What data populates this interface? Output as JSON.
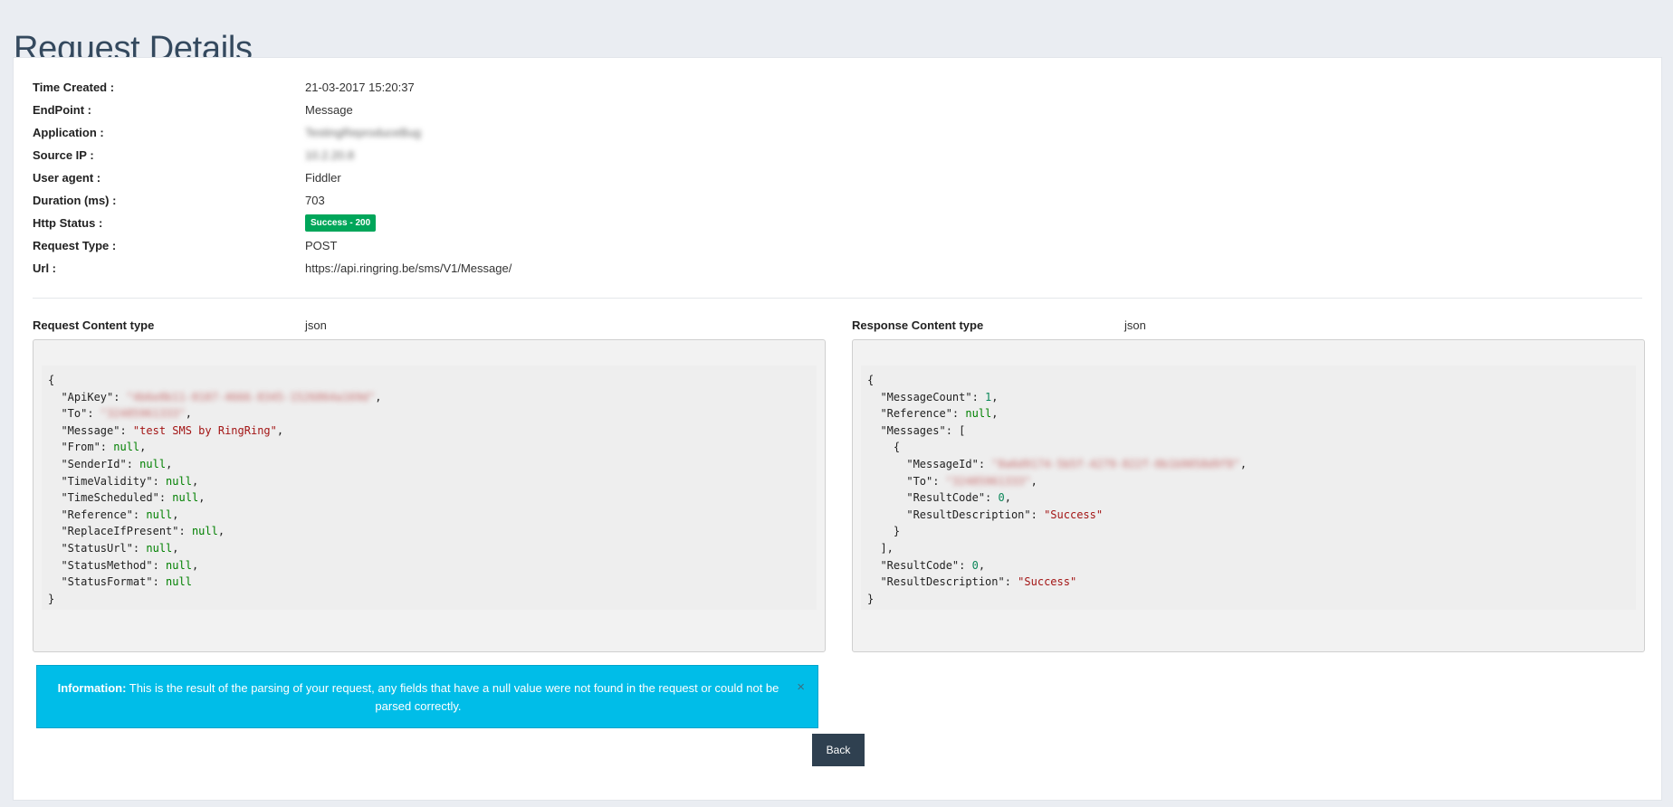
{
  "page": {
    "title": "Request Details"
  },
  "details": [
    {
      "label": "Time Created :",
      "value": "21-03-2017 15:20:37"
    },
    {
      "label": "EndPoint :",
      "value": "Message"
    },
    {
      "label": "Application :",
      "value": "TestingReproduceBug",
      "redacted": true
    },
    {
      "label": "Source IP :",
      "value": "10.2.20.8",
      "redacted": true
    },
    {
      "label": "User agent :",
      "value": "Fiddler"
    },
    {
      "label": "Duration (ms) :",
      "value": "703"
    },
    {
      "label": "Http Status :",
      "value": "Success - 200",
      "badge": true,
      "badge_color": "#00a65a"
    },
    {
      "label": "Request Type :",
      "value": "POST"
    },
    {
      "label": "Url :",
      "value": "https://api.ringring.be/sms/V1/Message/"
    }
  ],
  "request": {
    "content_type_label": "Request Content type",
    "content_type": "json"
  },
  "response": {
    "content_type_label": "Response Content type",
    "content_type": "json"
  },
  "alert": {
    "title": "Information:",
    "text": "This is the result of the parsing of your request, any fields that have a null value were not found in the request or could not be parsed correctly.",
    "close_icon": "×"
  },
  "back_label": "Back",
  "colors": {
    "accent": "#00bde8",
    "button": "#2f4050",
    "success": "#00a65a",
    "title": "#34495e"
  }
}
